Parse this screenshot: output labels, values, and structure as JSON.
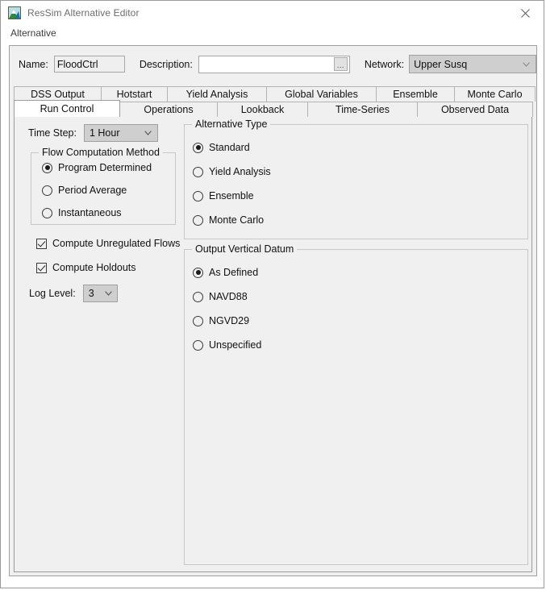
{
  "window": {
    "title": "ResSim Alternative Editor",
    "icon": "app-icon",
    "close_label": "✕"
  },
  "menubar": {
    "items": [
      {
        "label": "Alternative"
      }
    ]
  },
  "form": {
    "name_label": "Name:",
    "name_value": "FloodCtrl",
    "description_label": "Description:",
    "description_value": "",
    "description_placeholder": "",
    "description_browse_label": "...",
    "network_label": "Network:",
    "network_value": "Upper Susq"
  },
  "tabs": {
    "row1": [
      {
        "label": "DSS Output",
        "selected": false
      },
      {
        "label": "Hotstart",
        "selected": false
      },
      {
        "label": "Yield Analysis",
        "selected": false
      },
      {
        "label": "Global Variables",
        "selected": false
      },
      {
        "label": "Ensemble",
        "selected": false
      },
      {
        "label": "Monte Carlo",
        "selected": false
      }
    ],
    "row2": [
      {
        "label": "Run Control",
        "selected": true
      },
      {
        "label": "Operations",
        "selected": false
      },
      {
        "label": "Lookback",
        "selected": false
      },
      {
        "label": "Time-Series",
        "selected": false
      },
      {
        "label": "Observed Data",
        "selected": false
      }
    ]
  },
  "run_control": {
    "time_step_label": "Time Step:",
    "time_step_value": "1 Hour",
    "flow_group_title": "Flow Computation Method",
    "flow_options": [
      {
        "label": "Program Determined",
        "checked": true
      },
      {
        "label": "Period Average",
        "checked": false
      },
      {
        "label": "Instantaneous",
        "checked": false
      }
    ],
    "compute_unregulated_label": "Compute Unregulated Flows",
    "compute_unregulated_checked": true,
    "compute_holdouts_label": "Compute Holdouts",
    "compute_holdouts_checked": true,
    "log_level_label": "Log Level:",
    "log_level_value": "3",
    "alt_type_group_title": "Alternative Type",
    "alt_type_options": [
      {
        "label": "Standard",
        "checked": true
      },
      {
        "label": "Yield Analysis",
        "checked": false
      },
      {
        "label": "Ensemble",
        "checked": false
      },
      {
        "label": "Monte Carlo",
        "checked": false
      }
    ],
    "datum_group_title": "Output Vertical Datum",
    "datum_options": [
      {
        "label": "As Defined",
        "checked": true
      },
      {
        "label": "NAVD88",
        "checked": false
      },
      {
        "label": "NGVD29",
        "checked": false
      },
      {
        "label": "Unspecified",
        "checked": false
      }
    ]
  },
  "colors": {
    "window_bg": "#ffffff",
    "panel_bg": "#f0f0f0",
    "combo_bg": "#cfcfcf",
    "border": "#a0a0a0",
    "text": "#111111",
    "title_text": "#6d6d6d"
  }
}
